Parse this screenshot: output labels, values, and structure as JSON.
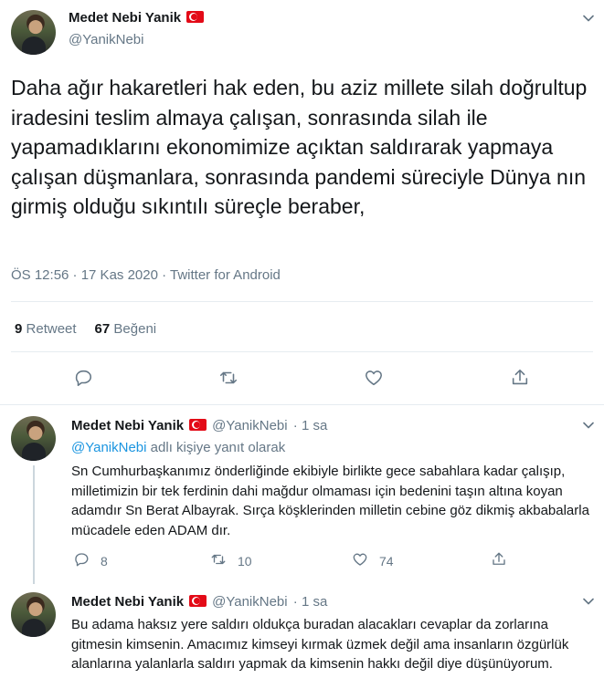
{
  "main_tweet": {
    "name": "Medet Nebi Yanik",
    "handle": "@YanikNebi",
    "text": "Daha ağır hakaretleri hak eden, bu aziz millete silah doğrultup iradesini teslim almaya çalışan, sonrasında silah ile yapamadıklarını ekonomimize açıktan saldırarak yapmaya çalışan düşmanlara, sonrasında pandemi süreciyle Dünya nın girmiş olduğu sıkıntılı süreçle beraber,",
    "meta": "ÖS 12:56 · 17 Kas 2020 · Twitter for Android",
    "retweet_count": "9",
    "retweet_label": "Retweet",
    "like_count": "67",
    "like_label": "Beğeni"
  },
  "replies": [
    {
      "name": "Medet Nebi Yanik",
      "handle": "@YanikNebi",
      "time": "· 1 sa",
      "replying_mention": "@YanikNebi",
      "replying_suffix": "adlı kişiye yanıt olarak",
      "text": "Sn Cumhurbaşkanımız önderliğinde ekibiyle birlikte gece sabahlara kadar çalışıp, milletimizin bir tek ferdinin dahi mağdur olmaması için bedenini taşın altına koyan adamdır Sn Berat Albayrak. Sırça köşklerinden milletin cebine göz dikmiş akbabalarla mücadele eden ADAM dır.",
      "reply_count": "8",
      "retweet_count": "10",
      "like_count": "74"
    },
    {
      "name": "Medet Nebi Yanik",
      "handle": "@YanikNebi",
      "time": "· 1 sa",
      "text": "Bu adama haksız yere saldırı oldukça buradan alacakları cevaplar da zorlarına gitmesin kimsenin. Amacımız kimseyi kırmak üzmek değil ama insanların özgürlük alanlarına yalanlarla saldırı yapmak da kimsenin hakkı değil diye düşünüyorum."
    }
  ],
  "icons": {
    "flag": "turkey-flag-icon",
    "more": "chevron-down-icon",
    "reply": "reply-icon",
    "retweet": "retweet-icon",
    "like": "heart-icon",
    "share": "share-icon"
  },
  "colors": {
    "secondary_text": "#657786",
    "link": "#1b95e0",
    "divider": "#e6ecf0"
  }
}
